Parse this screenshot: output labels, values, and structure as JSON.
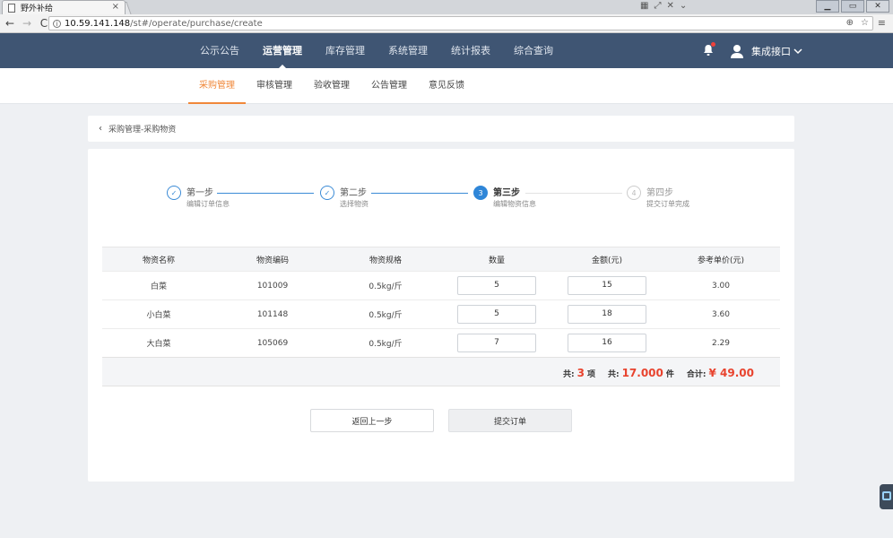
{
  "browser": {
    "tab_title": "野外补给",
    "tab_close": "×",
    "address_host": "10.59.141.148",
    "address_path": "/st#/operate/purchase/create",
    "back": "←",
    "forward": "→",
    "reload": "C"
  },
  "header": {
    "nav": [
      "公示公告",
      "运营管理",
      "库存管理",
      "系统管理",
      "统计报表",
      "综合查询"
    ],
    "active_nav_index": 1,
    "user_name": "集成接口"
  },
  "sub_nav": {
    "items": [
      "采购管理",
      "审核管理",
      "验收管理",
      "公告管理",
      "意见反馈"
    ],
    "active_index": 0
  },
  "breadcrumb": {
    "text": "采购管理-采购物资"
  },
  "steps": [
    {
      "title": "第一步",
      "desc": "编辑订单信息",
      "state": "done",
      "marker": "✓"
    },
    {
      "title": "第二步",
      "desc": "选择物资",
      "state": "done",
      "marker": "✓"
    },
    {
      "title": "第三步",
      "desc": "编辑物资信息",
      "state": "current",
      "marker": "3"
    },
    {
      "title": "第四步",
      "desc": "提交订单完成",
      "state": "todo",
      "marker": "4"
    }
  ],
  "table": {
    "columns": [
      "物资名称",
      "物资编码",
      "物资规格",
      "数量",
      "金额(元)",
      "参考单价(元)"
    ],
    "rows": [
      {
        "name": "白菜",
        "code": "101009",
        "spec": "0.5kg/斤",
        "qty": "5",
        "amount": "15",
        "price": "3.00"
      },
      {
        "name": "小白菜",
        "code": "101148",
        "spec": "0.5kg/斤",
        "qty": "5",
        "amount": "18",
        "price": "3.60"
      },
      {
        "name": "大白菜",
        "code": "105069",
        "spec": "0.5kg/斤",
        "qty": "7",
        "amount": "16",
        "price": "2.29"
      }
    ]
  },
  "summary": {
    "items_prefix": "共:",
    "items_count": "3",
    "items_unit": "项",
    "qty_prefix": "共:",
    "qty_total": "17.000",
    "qty_unit": "件",
    "total_prefix": "合计:",
    "total_amount": "¥ 49.00"
  },
  "buttons": {
    "prev": "返回上一步",
    "submit": "提交订单"
  },
  "colors": {
    "header_bg": "#3f5573",
    "accent_orange": "#f0883a",
    "step_blue": "#2f86d8",
    "price_red": "#e8432e"
  }
}
